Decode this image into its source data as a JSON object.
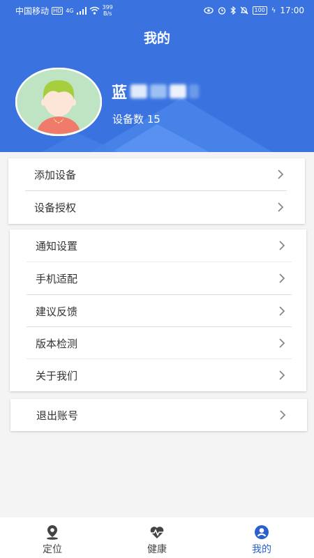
{
  "status_bar": {
    "carrier": "中国移动",
    "hd_badge": "HD",
    "signal_text": "4G",
    "speed_value": "399",
    "speed_unit": "B/s",
    "battery": "100",
    "time": "17:00"
  },
  "header": {
    "title": "我的"
  },
  "profile": {
    "name_visible": "蓝",
    "device_count": "设备数 15"
  },
  "menu_groups": [
    {
      "items": [
        {
          "label": "添加设备"
        },
        {
          "label": "设备授权"
        }
      ]
    },
    {
      "items": [
        {
          "label": "通知设置"
        },
        {
          "label": "手机适配"
        },
        {
          "label": "建议反馈"
        },
        {
          "label": "版本检测"
        },
        {
          "label": "关于我们"
        }
      ]
    },
    {
      "items": [
        {
          "label": "退出账号"
        }
      ]
    }
  ],
  "tabbar": {
    "tabs": [
      {
        "label": "定位",
        "icon": "location-pin-icon"
      },
      {
        "label": "健康",
        "icon": "heart-pulse-icon"
      },
      {
        "label": "我的",
        "icon": "user-icon"
      }
    ],
    "active_index": 2
  },
  "colors": {
    "header_bg": "#3a73e0",
    "active_tab": "#2a5fd0",
    "page_bg": "#f4f4f4"
  }
}
